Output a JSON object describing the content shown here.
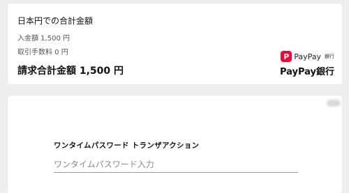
{
  "summary": {
    "title": "日本円での合計金額",
    "deposit_line": "入金額 1,500 円",
    "fee_line": "取引手数料 0 円",
    "total_line": "請求合計金額 1,500 円",
    "logo_mark": "P",
    "logo_text": "PayPay",
    "logo_sub": "銀行",
    "bank_name": "PayPay銀行"
  },
  "otp": {
    "label": "ワンタイムパスワード トランザアクション",
    "placeholder": "ワンタイムパスワード入力",
    "value": ""
  },
  "colors": {
    "brand_red": "#ff0033",
    "background": "#efefef"
  }
}
